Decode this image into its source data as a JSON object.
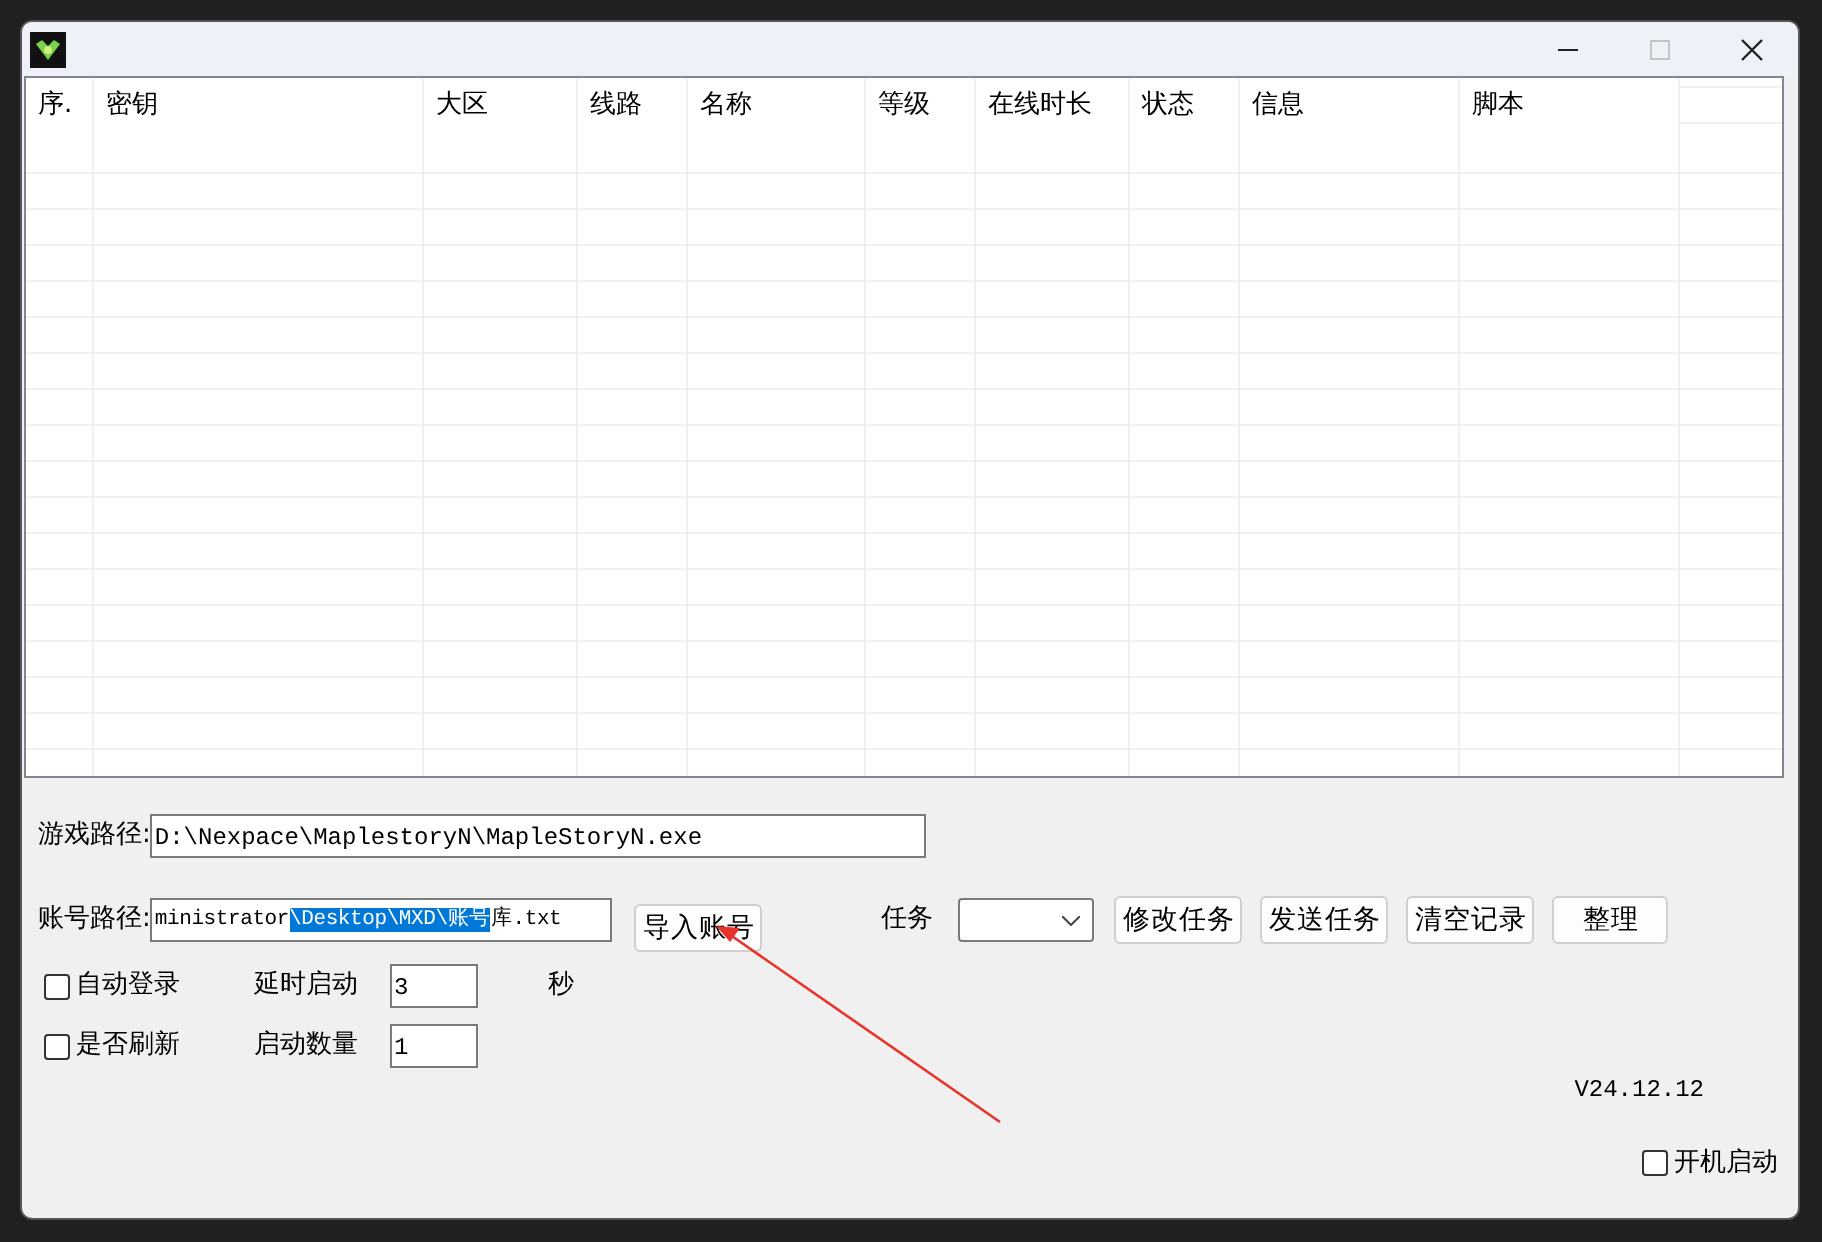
{
  "window": {
    "controls": [
      {
        "kind": "minimize",
        "disabled": false
      },
      {
        "kind": "maximize",
        "disabled": true
      },
      {
        "kind": "close",
        "disabled": false
      }
    ]
  },
  "table": {
    "columns": [
      "序.",
      "密钥",
      "大区",
      "线路",
      "名称",
      "等级",
      "在线时长",
      "状态",
      "信息",
      "脚本"
    ]
  },
  "game_path": {
    "label": "游戏路径:",
    "value": "D:\\Nexpace\\MaplestoryN\\MapleStoryN.exe"
  },
  "account_path": {
    "label": "账号路径:",
    "value_before": "ministrator",
    "value_selected": "\\Desktop\\MXD\\账号",
    "value_after": "库.txt"
  },
  "import_button": "导入账号",
  "task": {
    "label": "任务"
  },
  "task_buttons": [
    "修改任务",
    "发送任务",
    "清空记录",
    "整理"
  ],
  "auto_login": {
    "label": "自动登录",
    "checked": false
  },
  "refresh": {
    "label": "是否刷新",
    "checked": false
  },
  "delay": {
    "label": "延时启动",
    "value": "3",
    "unit": "秒"
  },
  "count": {
    "label": "启动数量",
    "value": "1"
  },
  "version": "V24.12.12",
  "autostart": {
    "label": "开机启动",
    "checked": false
  }
}
